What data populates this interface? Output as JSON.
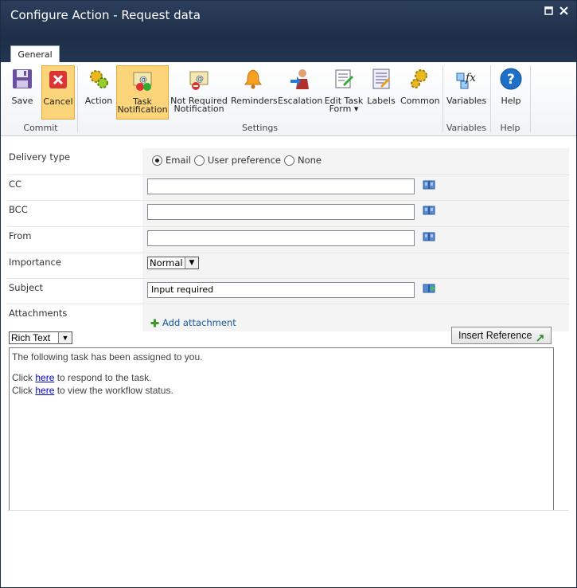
{
  "window": {
    "title": "Configure Action - Request data"
  },
  "tabs": {
    "general": "General"
  },
  "ribbon": {
    "groups": {
      "commit": "Commit",
      "settings": "Settings",
      "variables": "Variables",
      "help": "Help"
    },
    "buttons": {
      "save": "Save",
      "cancel": "Cancel",
      "action": "Action",
      "task_notification_1": "Task",
      "task_notification_2": "Notification",
      "not_required_1": "Not Required",
      "not_required_2": "Notification",
      "reminders": "Reminders",
      "escalation": "Escalation",
      "edit_task_form_1": "Edit Task",
      "edit_task_form_2": "Form",
      "labels": "Labels",
      "common": "Common",
      "variables": "Variables",
      "help": "Help"
    }
  },
  "form": {
    "delivery_type": {
      "label": "Delivery type",
      "options": [
        "Email",
        "User preference",
        "None"
      ],
      "selected": "Email"
    },
    "cc": {
      "label": "CC",
      "value": ""
    },
    "bcc": {
      "label": "BCC",
      "value": ""
    },
    "from": {
      "label": "From",
      "value": ""
    },
    "importance": {
      "label": "Importance",
      "value": "Normal"
    },
    "subject": {
      "label": "Subject",
      "value": "Input required"
    },
    "attachments": {
      "label": "Attachments",
      "add_link": "Add attachment"
    }
  },
  "editor": {
    "format": "Rich Text",
    "insert_reference": "Insert Reference",
    "line1": "The following task has been assigned to you.",
    "click": "Click",
    "here": "here",
    "respond_tail": "to respond to the task.",
    "view_tail": "to view the workflow status."
  }
}
